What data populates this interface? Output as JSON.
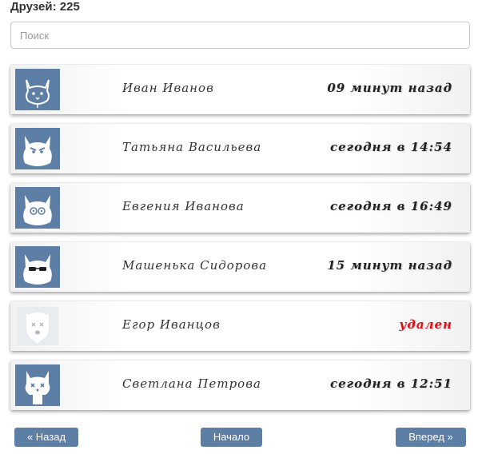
{
  "header": {
    "title": "Друзей: 225"
  },
  "search": {
    "placeholder": "Поиск"
  },
  "friends": [
    {
      "name": "Иван Иванов",
      "status": "09 минут назад",
      "avatar": "cat-icon",
      "deleted": false
    },
    {
      "name": "Татьяна Васильева",
      "status": "сегодня в 14:54",
      "avatar": "angry-cat-icon",
      "deleted": false
    },
    {
      "name": "Евгения Иванова",
      "status": "сегодня в 16:49",
      "avatar": "dizzy-cat-icon",
      "deleted": false
    },
    {
      "name": "Машенька Сидорова",
      "status": "15 минут назад",
      "avatar": "sunglasses-cat-icon",
      "deleted": false
    },
    {
      "name": "Егор Иванцов",
      "status": "удален",
      "avatar": "deleted-dog-icon",
      "deleted": true
    },
    {
      "name": "Светлана Петрова",
      "status": "сегодня в 12:51",
      "avatar": "dead-cat-icon",
      "deleted": false
    }
  ],
  "pagination": {
    "back_label": "« Назад",
    "home_label": "Начало",
    "next_label": "Вперед »"
  },
  "colors": {
    "accent": "#5d7fa6",
    "deleted_text": "#e0101a",
    "deleted_avatar_bg": "#e9ecef"
  }
}
